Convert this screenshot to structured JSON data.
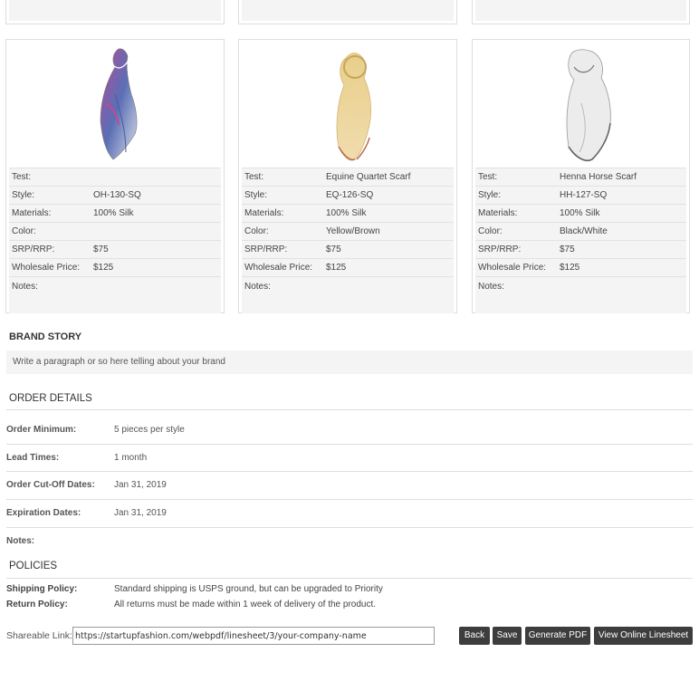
{
  "products": [
    {
      "image": "pink-blue-silk-scarf",
      "rows": [
        {
          "label": "Test:",
          "value": ""
        },
        {
          "label": "Style:",
          "value": "OH-130-SQ"
        },
        {
          "label": "Materials:",
          "value": "100% Silk"
        },
        {
          "label": "Color:",
          "value": ""
        },
        {
          "label": "SRP/RRP:",
          "value": "$75"
        },
        {
          "label": "Wholesale Price:",
          "value": "$125"
        },
        {
          "label": "Notes:",
          "value": ""
        }
      ]
    },
    {
      "image": "yellow-brown-silk-scarf",
      "rows": [
        {
          "label": "Test:",
          "value": "Equine Quartet Scarf"
        },
        {
          "label": "Style:",
          "value": "EQ-126-SQ"
        },
        {
          "label": "Materials:",
          "value": "100% Silk"
        },
        {
          "label": "Color:",
          "value": "Yellow/Brown"
        },
        {
          "label": "SRP/RRP:",
          "value": "$75"
        },
        {
          "label": "Wholesale Price:",
          "value": "$125"
        },
        {
          "label": "Notes:",
          "value": ""
        }
      ]
    },
    {
      "image": "black-white-silk-scarf",
      "rows": [
        {
          "label": "Test:",
          "value": "Henna Horse Scarf"
        },
        {
          "label": "Style:",
          "value": "HH-127-SQ"
        },
        {
          "label": "Materials:",
          "value": "100% Silk"
        },
        {
          "label": "Color:",
          "value": "Black/White"
        },
        {
          "label": "SRP/RRP:",
          "value": "$75"
        },
        {
          "label": "Wholesale Price:",
          "value": "$125"
        },
        {
          "label": "Notes:",
          "value": ""
        }
      ]
    }
  ],
  "brand_story": {
    "title": "BRAND STORY",
    "text": "Write a paragraph or so here telling about your brand"
  },
  "order_details": {
    "title": "ORDER DETAILS",
    "rows": [
      {
        "label": "Order Minimum:",
        "value": "5 pieces per style"
      },
      {
        "label": "Lead Times:",
        "value": "1 month"
      },
      {
        "label": "Order Cut-Off Dates:",
        "value": "Jan 31, 2019"
      },
      {
        "label": "Expiration Dates:",
        "value": "Jan 31, 2019"
      },
      {
        "label": "Notes:",
        "value": ""
      }
    ]
  },
  "policies": {
    "title": "POLICIES",
    "rows": [
      {
        "label": "Shipping Policy:",
        "value": "Standard shipping is USPS ground, but can be upgraded to Priority"
      },
      {
        "label": "Return Policy:",
        "value": "All returns must be made within 1 week of delivery of the product."
      }
    ]
  },
  "share": {
    "label": "Shareable Link:",
    "url": "https://startupfashion.com/webpdf/linesheet/3/your-company-name"
  },
  "buttons": {
    "back": "Back",
    "save": "Save",
    "generate_pdf": "Generate PDF",
    "view_online": "View Online Linesheet"
  }
}
